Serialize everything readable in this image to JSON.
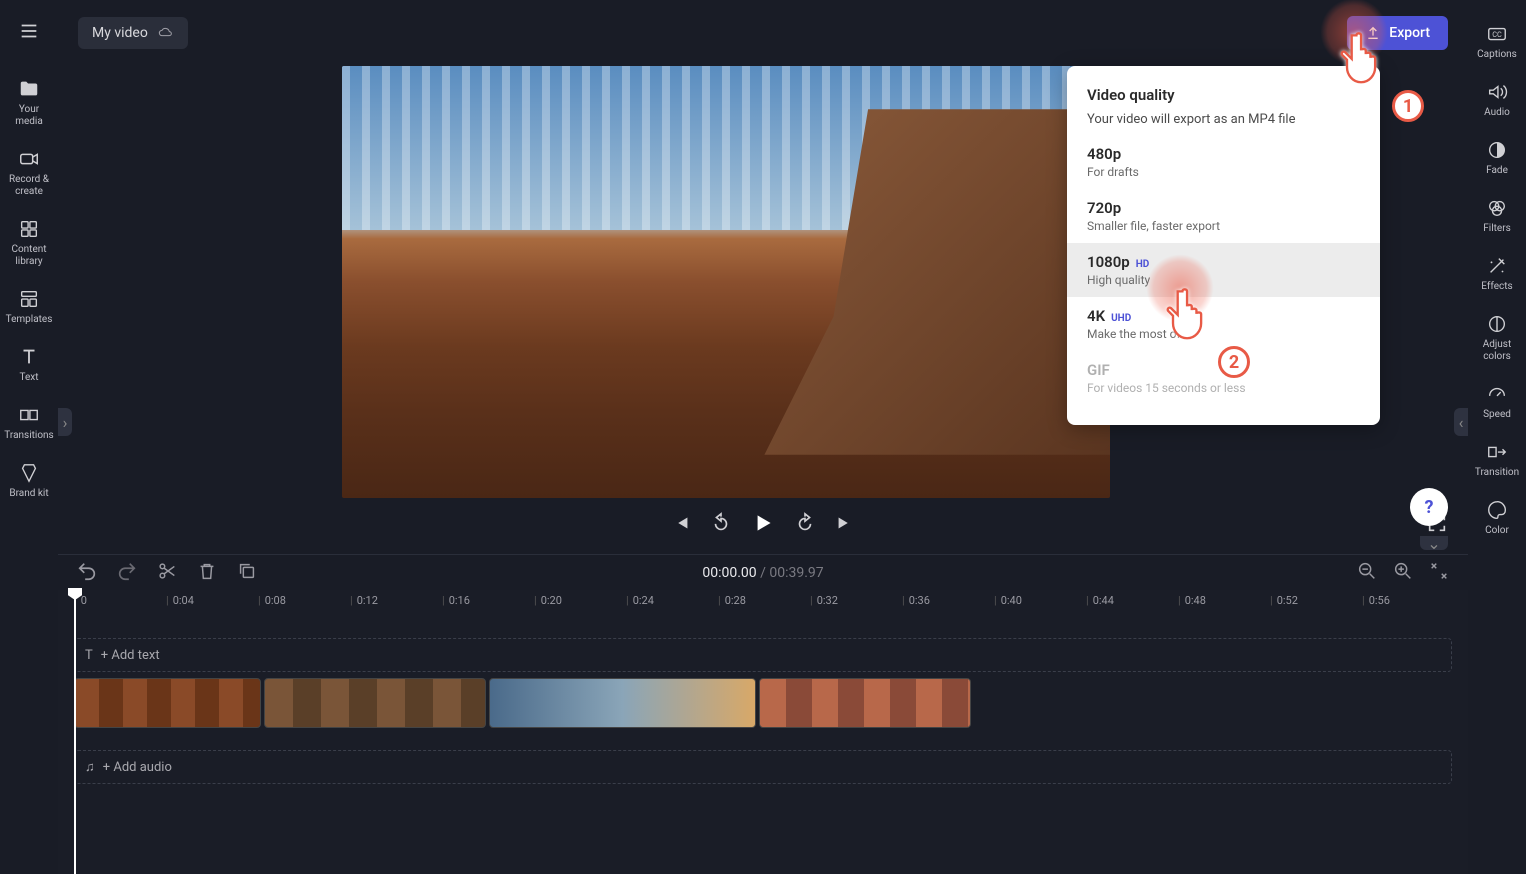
{
  "project": {
    "title": "My video"
  },
  "export": {
    "label": "Export"
  },
  "leftRail": {
    "items": [
      {
        "label": "Your media"
      },
      {
        "label": "Record & create"
      },
      {
        "label": "Content library"
      },
      {
        "label": "Templates"
      },
      {
        "label": "Text"
      },
      {
        "label": "Transitions"
      },
      {
        "label": "Brand kit"
      }
    ]
  },
  "rightRail": {
    "items": [
      {
        "label": "Captions"
      },
      {
        "label": "Audio"
      },
      {
        "label": "Fade"
      },
      {
        "label": "Filters"
      },
      {
        "label": "Effects"
      },
      {
        "label": "Adjust colors"
      },
      {
        "label": "Speed"
      },
      {
        "label": "Transition"
      },
      {
        "label": "Color"
      }
    ]
  },
  "exportMenu": {
    "title": "Video quality",
    "subtitle": "Your video will export as an MP4 file",
    "options": [
      {
        "title": "480p",
        "desc": "For drafts",
        "badge": ""
      },
      {
        "title": "720p",
        "desc": "Smaller file, faster export",
        "badge": ""
      },
      {
        "title": "1080p",
        "desc": "High quality",
        "badge": "HD"
      },
      {
        "title": "4K",
        "desc": "Make the most of",
        "badge": "UHD"
      },
      {
        "title": "GIF",
        "desc": "For videos 15 seconds or less",
        "badge": "",
        "disabled": true
      }
    ]
  },
  "playback": {
    "currentTime": "00:00.00",
    "totalTime": "00:39.97"
  },
  "timeline": {
    "ticks": [
      "0",
      "0:04",
      "0:08",
      "0:12",
      "0:16",
      "0:20",
      "0:24",
      "0:28",
      "0:32",
      "0:36",
      "0:40",
      "0:44",
      "0:48",
      "0:52",
      "0:56"
    ],
    "textTrackLabel": "+ Add text",
    "audioTrackLabel": "+ Add audio"
  },
  "annotations": {
    "step1": "1",
    "step2": "2"
  },
  "help": {
    "label": "?"
  }
}
